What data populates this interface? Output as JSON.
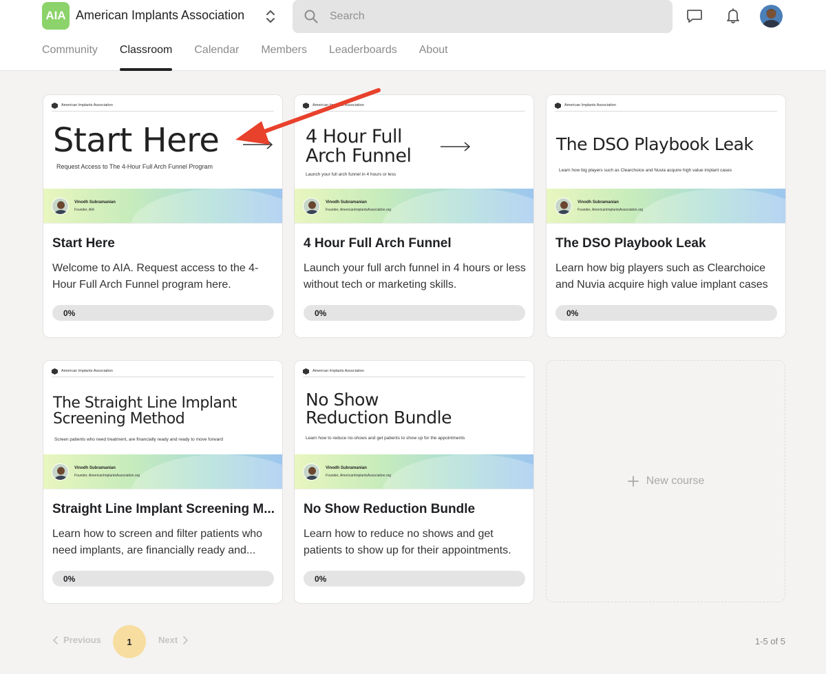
{
  "header": {
    "logo_text": "AIA",
    "org_name": "American Implants Association",
    "search_placeholder": "Search",
    "tabs": [
      "Community",
      "Classroom",
      "Calendar",
      "Members",
      "Leaderboards",
      "About"
    ],
    "active_tab": "Classroom"
  },
  "colors": {
    "brand": "#8bd36a",
    "page_bg": "#f4f3f1",
    "annotation_arrow": "#e8412c",
    "current_page_bg": "#f7dea0"
  },
  "courses": [
    {
      "thumb_org": "American Implants Association",
      "thumb_title": "Start Here",
      "thumb_subtitle": "Request Access to The 4-Hour Full Arch Funnel Program",
      "thumb_author": "Vinodh Subramanian",
      "thumb_role": "Founder, AIA",
      "title": "Start Here",
      "description": "Welcome to AIA. Request access to the 4-Hour Full Arch Funnel program here.",
      "progress_label": "0%",
      "progress_value": 0
    },
    {
      "thumb_org": "American Implants Association",
      "thumb_title": "4 Hour Full Arch Funnel",
      "thumb_title_line1": "4 Hour Full",
      "thumb_title_line2": "Arch Funnel",
      "thumb_subtitle": "Launch your full arch funnel in 4 hours or less",
      "thumb_author": "Vinodh Subramanian",
      "thumb_role": "Founder, AmericanImplantsAssociation.org",
      "title": "4 Hour Full Arch Funnel",
      "description": "Launch your full arch funnel in 4 hours or less without tech or marketing skills.",
      "progress_label": "0%",
      "progress_value": 0
    },
    {
      "thumb_org": "American Implants Association",
      "thumb_title": "The DSO Playbook Leak",
      "thumb_subtitle": "Learn how big players such as Clearchoice and Nuvia acquire high value implant cases",
      "thumb_author": "Vinodh Subramanian",
      "thumb_role": "Founder, AmericanImplantsAssociation.org",
      "title": "The DSO Playbook Leak",
      "description": "Learn how big players such as Clearchoice and Nuvia acquire high value implant cases",
      "progress_label": "0%",
      "progress_value": 0
    },
    {
      "thumb_org": "American Implants Association",
      "thumb_title_line1": "The Straight Line Implant",
      "thumb_title_line2": "Screening Method",
      "thumb_subtitle": "Screen patients who need treatment, are financially ready and ready to move forward",
      "thumb_author": "Vinodh Subramanian",
      "thumb_role": "Founder, AmericanImplantsAssociation.org",
      "title": "Straight Line Implant Screening M...",
      "description": "Learn how to screen and filter patients who need implants, are financially ready and...",
      "progress_label": "0%",
      "progress_value": 0
    },
    {
      "thumb_org": "American Implants Association",
      "thumb_title_line1": "No Show",
      "thumb_title_line2": "Reduction Bundle",
      "thumb_subtitle": "Learn how to reduce no-shows and get patients to show up for the appointments",
      "thumb_author": "Vinodh Subramanian",
      "thumb_role": "Founder, AmericanImplantsAssociation.org",
      "title": "No Show Reduction Bundle",
      "description": "Learn how to reduce no shows and get patients to show up for their appointments.",
      "progress_label": "0%",
      "progress_value": 0
    }
  ],
  "new_course_label": "New course",
  "pagination": {
    "previous_label": "Previous",
    "current_page": "1",
    "next_label": "Next",
    "count_text": "1-5 of 5"
  }
}
